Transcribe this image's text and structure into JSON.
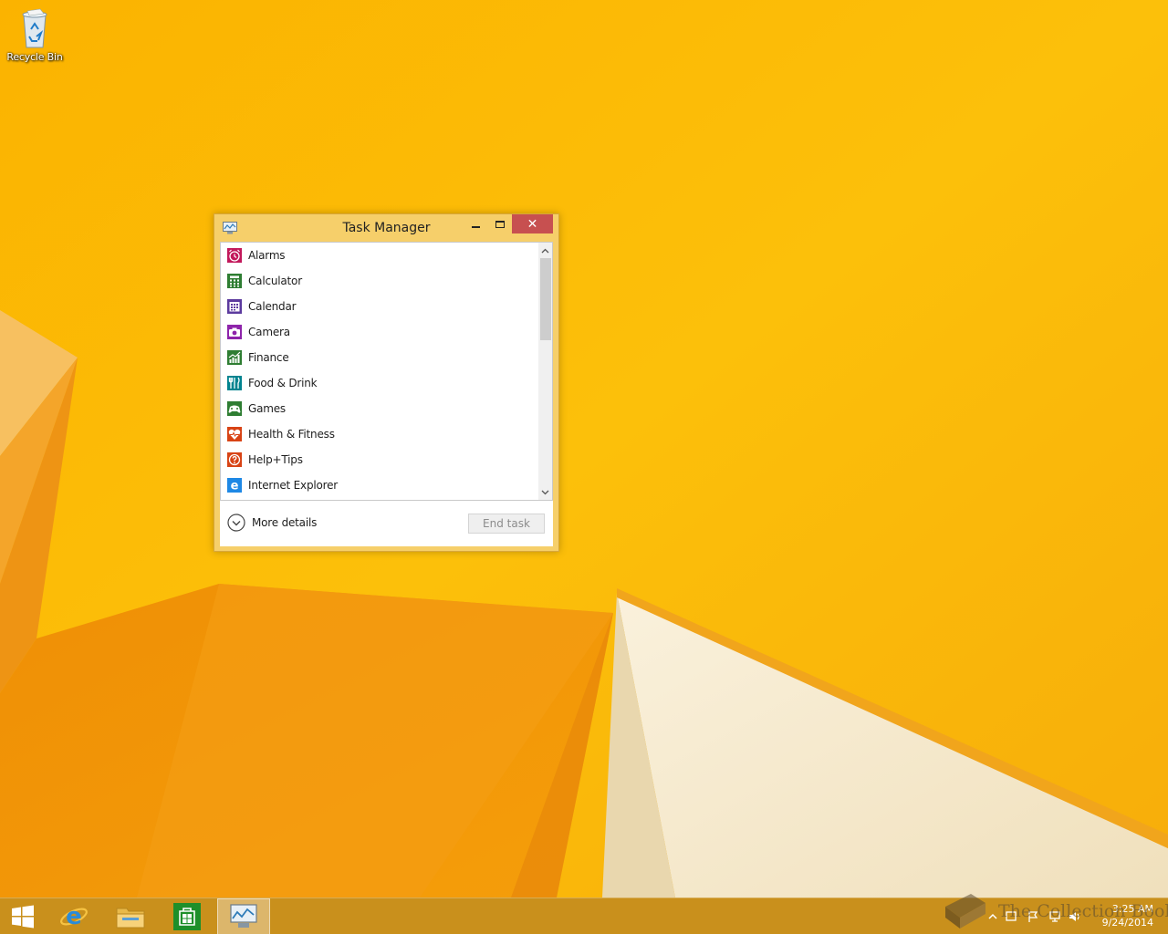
{
  "desktop": {
    "recycle_bin_label": "Recycle Bin"
  },
  "window": {
    "title": "Task Manager",
    "apps": [
      {
        "name": "Alarms",
        "icon": "alarm-icon",
        "color": "#c2185b"
      },
      {
        "name": "Calculator",
        "icon": "calculator-icon",
        "color": "#2e7d32"
      },
      {
        "name": "Calendar",
        "icon": "calendar-icon",
        "color": "#5c3a9e"
      },
      {
        "name": "Camera",
        "icon": "camera-icon",
        "color": "#8e24aa"
      },
      {
        "name": "Finance",
        "icon": "finance-icon",
        "color": "#2e7d32"
      },
      {
        "name": "Food & Drink",
        "icon": "food-drink-icon",
        "color": "#00838f"
      },
      {
        "name": "Games",
        "icon": "games-icon",
        "color": "#2e7d32"
      },
      {
        "name": "Health & Fitness",
        "icon": "health-fitness-icon",
        "color": "#d84315"
      },
      {
        "name": "Help+Tips",
        "icon": "help-tips-icon",
        "color": "#d84315"
      },
      {
        "name": "Internet Explorer",
        "icon": "internet-explorer-icon",
        "color": "#1e88e5"
      }
    ],
    "more_details_label": "More details",
    "end_task_label": "End task"
  },
  "taskbar": {
    "pinned": [
      "start-icon",
      "internet-explorer-icon",
      "file-explorer-icon",
      "store-icon",
      "task-manager-icon"
    ],
    "clock_time": "3:25 AM",
    "clock_date": "9/24/2014"
  },
  "watermark": {
    "text": "The Collection Book"
  },
  "colors": {
    "wallpaper": "#fbb800",
    "window_frame": "#f6cf6a",
    "close_button": "#c75050"
  }
}
